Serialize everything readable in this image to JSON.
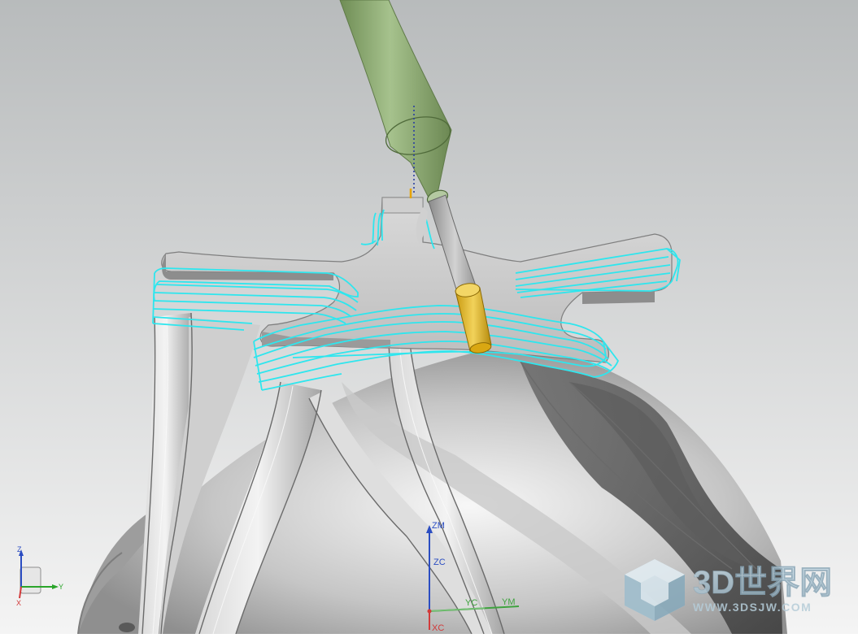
{
  "viewport": {
    "background_top": "#b9bcbd",
    "background_bottom": "#f3f3f3",
    "part_color": "#b4b4b4",
    "toolpath_color": "#2ee6ee",
    "tool_holder_color": "#88a86e",
    "tool_color": "#e0b32a"
  },
  "triad": {
    "z_label": "Z",
    "y_label": "Y",
    "x_label": "X"
  },
  "mcs": {
    "zm_label": "ZM",
    "zc_label": "ZC",
    "yc_label": "YC",
    "ym_label": "YM",
    "xc_label": "XC"
  },
  "watermark": {
    "title": "3D世界网",
    "url": "WWW.3DSJW.COM",
    "icon": "cube-logo-icon"
  }
}
